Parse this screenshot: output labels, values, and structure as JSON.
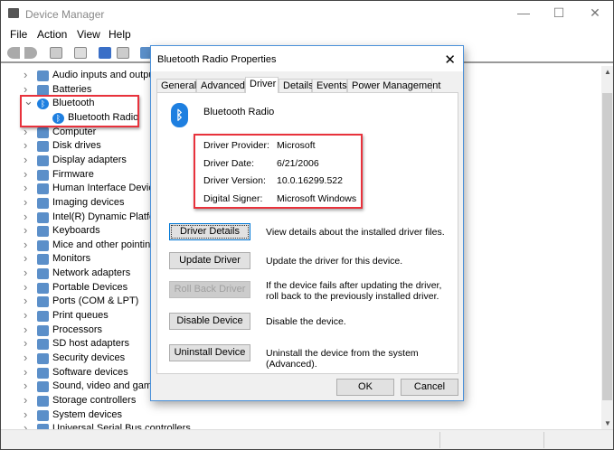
{
  "window": {
    "title": "Device Manager",
    "minimize": "—",
    "maximize": "☐",
    "close": "✕"
  },
  "menu": [
    "File",
    "Action",
    "View",
    "Help"
  ],
  "tree": [
    {
      "label": "Audio inputs and outputs",
      "expanded": false
    },
    {
      "label": "Batteries",
      "expanded": false
    },
    {
      "label": "Bluetooth",
      "expanded": true,
      "icon": "bluetooth"
    },
    {
      "label": "Bluetooth Radio",
      "child": true,
      "icon": "bluetooth"
    },
    {
      "label": "Computer"
    },
    {
      "label": "Disk drives"
    },
    {
      "label": "Display adapters"
    },
    {
      "label": "Firmware"
    },
    {
      "label": "Human Interface Devices"
    },
    {
      "label": "Imaging devices"
    },
    {
      "label": "Intel(R) Dynamic Platform"
    },
    {
      "label": "Keyboards"
    },
    {
      "label": "Mice and other pointing devices"
    },
    {
      "label": "Monitors"
    },
    {
      "label": "Network adapters"
    },
    {
      "label": "Portable Devices"
    },
    {
      "label": "Ports (COM & LPT)"
    },
    {
      "label": "Print queues"
    },
    {
      "label": "Processors"
    },
    {
      "label": "SD host adapters"
    },
    {
      "label": "Security devices"
    },
    {
      "label": "Software devices"
    },
    {
      "label": "Sound, video and game controllers"
    },
    {
      "label": "Storage controllers"
    },
    {
      "label": "System devices"
    },
    {
      "label": "Universal Serial Bus controllers"
    }
  ],
  "dialog": {
    "title": "Bluetooth Radio Properties",
    "close": "✕",
    "tabs": [
      "General",
      "Advanced",
      "Driver",
      "Details",
      "Events",
      "Power Management"
    ],
    "active_tab": "Driver",
    "device_name": "Bluetooth Radio",
    "fields": [
      {
        "label": "Driver Provider:",
        "value": "Microsoft"
      },
      {
        "label": "Driver Date:",
        "value": "6/21/2006"
      },
      {
        "label": "Driver Version:",
        "value": "10.0.16299.522"
      },
      {
        "label": "Digital Signer:",
        "value": "Microsoft Windows"
      }
    ],
    "actions": [
      {
        "button": "Driver Details",
        "desc": "View details about the installed driver files.",
        "focused": true
      },
      {
        "button": "Update Driver",
        "desc": "Update the driver for this device."
      },
      {
        "button": "Roll Back Driver",
        "desc": "If the device fails after updating the driver, roll back to the previously installed driver.",
        "disabled": true
      },
      {
        "button": "Disable Device",
        "desc": "Disable the device."
      },
      {
        "button": "Uninstall Device",
        "desc": "Uninstall the device from the system (Advanced)."
      }
    ],
    "ok": "OK",
    "cancel": "Cancel"
  },
  "colors": {
    "highlight": "#e8323c",
    "accent": "#0078d7",
    "bluetooth": "#1e7fe0"
  }
}
